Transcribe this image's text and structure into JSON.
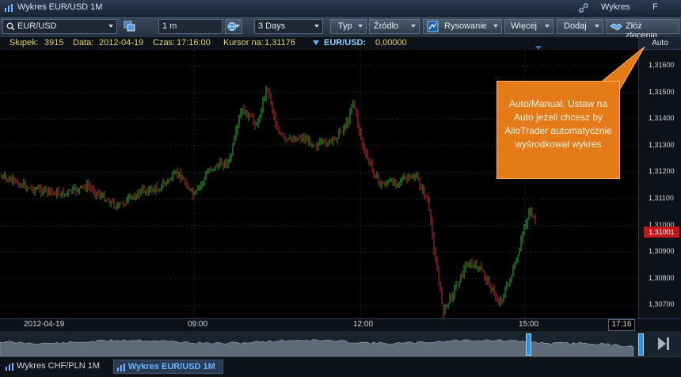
{
  "window": {
    "title": "Wykres EUR/USD 1M",
    "right_label": "Wykres",
    "f_button": "F"
  },
  "toolbar": {
    "symbol": "EUR/USD",
    "interval": "1 m",
    "range": "3 Days",
    "typ": "Typ",
    "zrodlo": "Źródło",
    "rysowanie": "Rysowanie",
    "wiecej": "Więcej",
    "dodaj": "Dodaj",
    "zloz": "Złóż zlecenie"
  },
  "info": {
    "slupek_label": "Słupek:",
    "slupek_value": "3915",
    "data_label": "Data:",
    "data_value": "2012-04-19",
    "czas_label": "Czas:",
    "czas_value": "17:16:00",
    "kursor_label": "Kursor na:",
    "kursor_value": "1,31176",
    "pair_label": "EUR/USD:",
    "pair_value": "0,00000"
  },
  "axis": {
    "auto_label": "Auto",
    "y_ticks": [
      "1,31600",
      "1,31500",
      "1,31400",
      "1,31300",
      "1,31200",
      "1,31100",
      "1,31000",
      "1,30900",
      "1,30800",
      "1,30700"
    ],
    "current_price": "1,31001",
    "x_ticks": [
      "2012-04-19",
      "09:00",
      "12:00",
      "15:00"
    ],
    "cursor_time": "17:16"
  },
  "callout": {
    "text": "Auto/Manual. Ustaw na Auto jeżeli chcesz by AlioTrader automatycznie wyśrodkował wykres"
  },
  "tabs": [
    {
      "label": "Wykres CHF/PLN 1M",
      "active": false
    },
    {
      "label": "Wykres EUR/USD 1M",
      "active": true
    }
  ],
  "colors": {
    "up": "#2ecc2e",
    "down": "#e03030",
    "callout": "#e57a18",
    "price_tag": "#c3151c"
  }
}
